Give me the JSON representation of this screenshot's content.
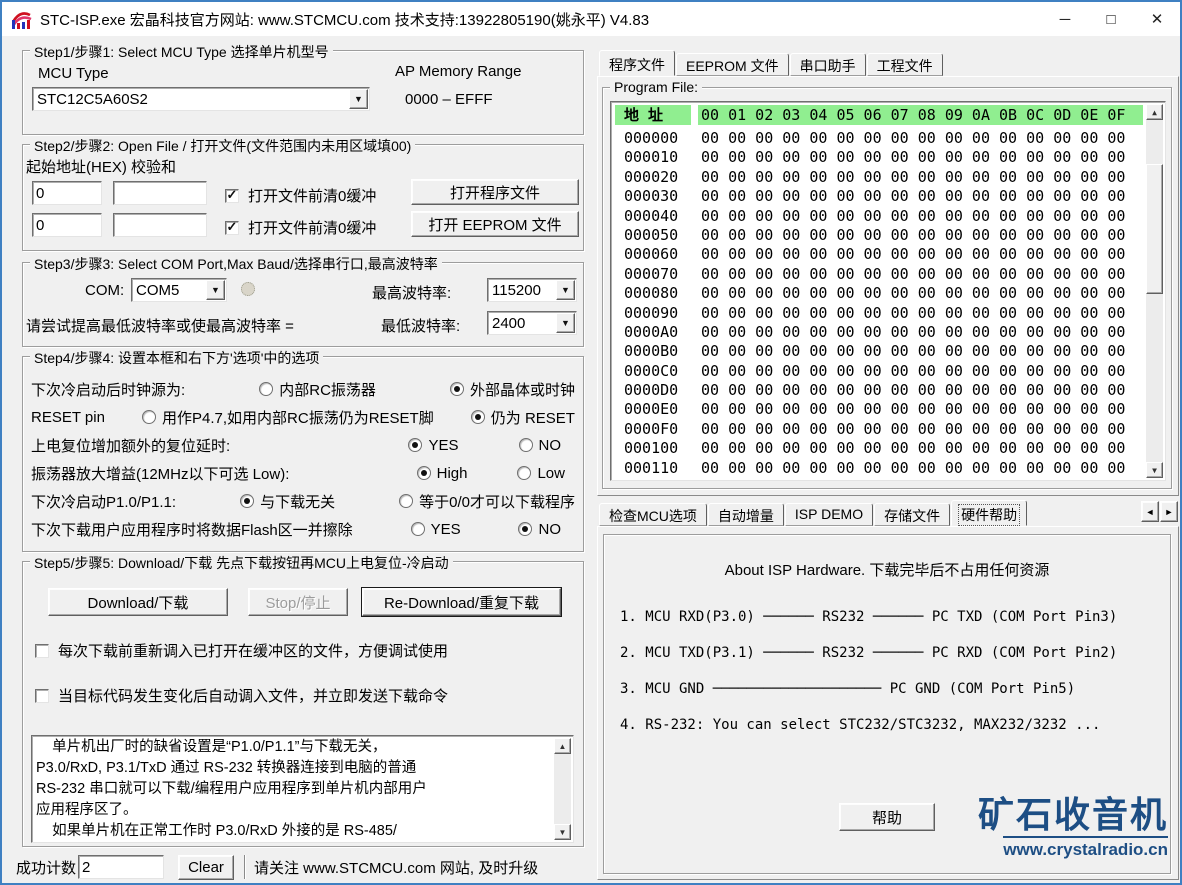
{
  "window": {
    "title": "STC-ISP.exe  宏晶科技官方网站: www.STCMCU.com  技术支持:13922805190(姚永平)  V4.83",
    "minimize": "─",
    "maximize": "□",
    "close": "✕"
  },
  "step1": {
    "group_title": "Step1/步骤1: Select MCU Type  选择单片机型号",
    "mcu_type_label": "MCU Type",
    "mcu_type_value": "STC12C5A60S2",
    "ap_range_label": "AP Memory Range",
    "ap_range_value": "0000   –   EFFF"
  },
  "step2": {
    "group_title": "Step2/步骤2: Open File / 打开文件(文件范围内未用区域填00)",
    "header_label": "起始地址(HEX) 校验和",
    "rows": [
      {
        "start": "0",
        "checksum": "",
        "clear_label": "打开文件前清0缓冲",
        "checked": true,
        "open_button": "打开程序文件"
      },
      {
        "start": "0",
        "checksum": "",
        "clear_label": "打开文件前清0缓冲",
        "checked": true,
        "open_button": "打开 EEPROM 文件"
      }
    ]
  },
  "step3": {
    "group_title": "Step3/步骤3: Select COM Port,Max Baud/选择串行口,最高波特率",
    "com_label": "COM:",
    "com_value": "COM5",
    "max_baud_label": "最高波特率:",
    "max_baud_value": "115200",
    "min_baud_hint": "请尝试提高最低波特率或使最高波特率 =",
    "min_baud_label": "最低波特率:",
    "min_baud_value": "2400"
  },
  "step4": {
    "group_title": "Step4/步骤4: 设置本框和右下方'选项'中的选项",
    "rows": [
      {
        "label": "下次冷启动后时钟源为:",
        "options": [
          "内部RC振荡器",
          "外部晶体或时钟"
        ],
        "selected": 1
      },
      {
        "label": "RESET pin",
        "options": [
          "用作P4.7,如用内部RC振荡仍为RESET脚",
          "仍为 RESET"
        ],
        "selected": 1
      },
      {
        "label": "上电复位增加额外的复位延时:",
        "options": [
          "YES",
          "NO"
        ],
        "selected": 0
      },
      {
        "label": "振荡器放大增益(12MHz以下可选 Low):",
        "options": [
          "High",
          "Low"
        ],
        "selected": 0
      },
      {
        "label": "下次冷启动P1.0/P1.1:",
        "options": [
          "与下载无关",
          "等于0/0才可以下载程序"
        ],
        "selected": 0
      },
      {
        "label": "下次下载用户应用程序时将数据Flash区一并擦除",
        "options": [
          "YES",
          "NO"
        ],
        "selected": 1
      }
    ]
  },
  "step5": {
    "group_title": "Step5/步骤5: Download/下载   先点下载按钮再MCU上电复位-冷启动",
    "download_button": "Download/下载",
    "stop_button": "Stop/停止",
    "stop_enabled": false,
    "redownload_button": "Re-Download/重复下载",
    "check1": {
      "label": "每次下载前重新调入已打开在缓冲区的文件，方便调试使用",
      "checked": false
    },
    "check2": {
      "label": "当目标代码发生变化后自动调入文件，并立即发送下载命令",
      "checked": false
    },
    "info_text": "    单片机出厂时的缺省设置是“P1.0/P1.1”与下载无关，\nP3.0/RxD, P3.1/TxD 通过 RS-232 转换器连接到电脑的普通\nRS-232 串口就可以下载/编程用户应用程序到单片机内部用户\n应用程序区了。\n    如果单片机在正常工作时 P3.0/RxD 外接的是 RS-485/"
  },
  "status": {
    "count_label": "成功计数",
    "count_value": "2",
    "clear_button": "Clear",
    "notice": "请关注 www.STCMCU.com 网站, 及时升级"
  },
  "right_top": {
    "tabs": [
      "程序文件",
      "EEPROM 文件",
      "串口助手",
      "工程文件"
    ],
    "active_tab": 0,
    "group_title": "Program File:",
    "hex": {
      "addr_header": "地 址",
      "col_header": "00 01 02 03 04 05 06 07 08 09 0A 0B 0C 0D 0E 0F",
      "rows": [
        {
          "addr": "000000",
          "values": "00 00 00 00 00 00 00 00 00 00 00 00 00 00 00 00"
        },
        {
          "addr": "000010",
          "values": "00 00 00 00 00 00 00 00 00 00 00 00 00 00 00 00"
        },
        {
          "addr": "000020",
          "values": "00 00 00 00 00 00 00 00 00 00 00 00 00 00 00 00"
        },
        {
          "addr": "000030",
          "values": "00 00 00 00 00 00 00 00 00 00 00 00 00 00 00 00"
        },
        {
          "addr": "000040",
          "values": "00 00 00 00 00 00 00 00 00 00 00 00 00 00 00 00"
        },
        {
          "addr": "000050",
          "values": "00 00 00 00 00 00 00 00 00 00 00 00 00 00 00 00"
        },
        {
          "addr": "000060",
          "values": "00 00 00 00 00 00 00 00 00 00 00 00 00 00 00 00"
        },
        {
          "addr": "000070",
          "values": "00 00 00 00 00 00 00 00 00 00 00 00 00 00 00 00"
        },
        {
          "addr": "000080",
          "values": "00 00 00 00 00 00 00 00 00 00 00 00 00 00 00 00"
        },
        {
          "addr": "000090",
          "values": "00 00 00 00 00 00 00 00 00 00 00 00 00 00 00 00"
        },
        {
          "addr": "0000A0",
          "values": "00 00 00 00 00 00 00 00 00 00 00 00 00 00 00 00"
        },
        {
          "addr": "0000B0",
          "values": "00 00 00 00 00 00 00 00 00 00 00 00 00 00 00 00"
        },
        {
          "addr": "0000C0",
          "values": "00 00 00 00 00 00 00 00 00 00 00 00 00 00 00 00"
        },
        {
          "addr": "0000D0",
          "values": "00 00 00 00 00 00 00 00 00 00 00 00 00 00 00 00"
        },
        {
          "addr": "0000E0",
          "values": "00 00 00 00 00 00 00 00 00 00 00 00 00 00 00 00"
        },
        {
          "addr": "0000F0",
          "values": "00 00 00 00 00 00 00 00 00 00 00 00 00 00 00 00"
        },
        {
          "addr": "000100",
          "values": "00 00 00 00 00 00 00 00 00 00 00 00 00 00 00 00"
        },
        {
          "addr": "000110",
          "values": "00 00 00 00 00 00 00 00 00 00 00 00 00 00 00 00"
        }
      ]
    }
  },
  "right_bottom": {
    "tabs": [
      "检查MCU选项",
      "自动增量",
      "ISP DEMO",
      "存储文件",
      "硬件帮助"
    ],
    "active_tab": 4,
    "scroll_left": "◄",
    "scroll_right": "►",
    "about_line": "About ISP Hardware.   下载完毕后不占用任何资源",
    "lines": [
      "1. MCU RXD(P3.0) ────── RS232 ────── PC TXD (COM Port Pin3)",
      "2. MCU TXD(P3.1) ────── RS232 ────── PC RXD (COM Port Pin2)",
      "3. MCU GND       ──────────────────── PC GND (COM Port Pin5)",
      "4. RS-232: You can select STC232/STC3232, MAX232/3232 ..."
    ],
    "help_button": "帮助"
  },
  "watermark": {
    "title": "矿石收音机",
    "url": "www.crystalradio.cn",
    "color": "#1d4e84"
  },
  "colors": {
    "hex_header_bg": "#90ee90",
    "window_border": "#3f80c2",
    "titlebar_bg": "#ffffff",
    "body_bg": "#f0f0f0"
  }
}
